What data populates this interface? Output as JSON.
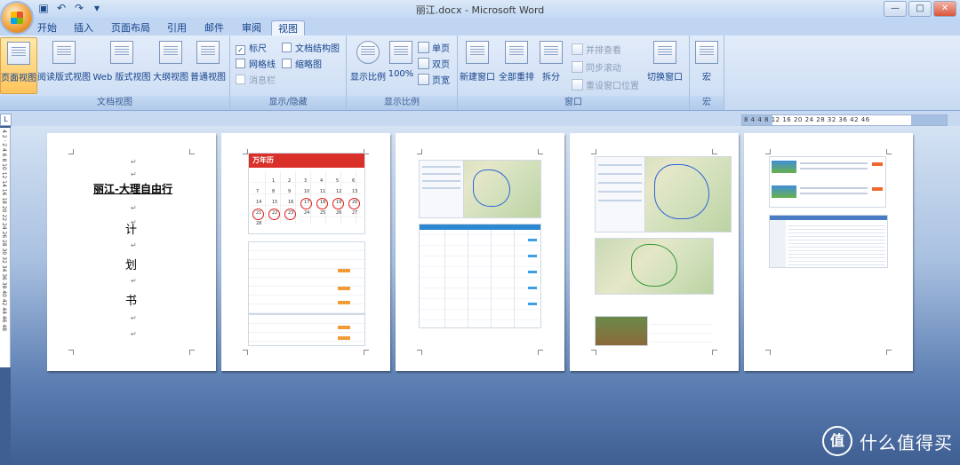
{
  "window": {
    "title": "丽江.docx - Microsoft Word",
    "controls": {
      "minimize": "—",
      "maximize": "□",
      "close": "✕"
    }
  },
  "quick_access": {
    "icons": [
      "save-icon",
      "undo-icon",
      "redo-icon",
      "customize-icon"
    ],
    "glyphs": [
      "▣",
      "↶",
      "↷",
      "▾"
    ]
  },
  "tabs": [
    {
      "label": "开始",
      "active": false
    },
    {
      "label": "插入",
      "active": false
    },
    {
      "label": "页面布局",
      "active": false
    },
    {
      "label": "引用",
      "active": false
    },
    {
      "label": "邮件",
      "active": false
    },
    {
      "label": "审阅",
      "active": false
    },
    {
      "label": "视图",
      "active": true
    }
  ],
  "ribbon": {
    "doc_views": {
      "label": "文档视图",
      "buttons": [
        {
          "label": "页面视图",
          "active": true
        },
        {
          "label": "阅读版式视图",
          "active": false
        },
        {
          "label": "Web 版式视图",
          "active": false
        },
        {
          "label": "大纲视图",
          "active": false
        },
        {
          "label": "普通视图",
          "active": false
        }
      ]
    },
    "show_hide": {
      "label": "显示/隐藏",
      "items": [
        {
          "label": "标尺",
          "checked": true,
          "enabled": true
        },
        {
          "label": "文档结构图",
          "checked": false,
          "enabled": true
        },
        {
          "label": "网格线",
          "checked": false,
          "enabled": true
        },
        {
          "label": "缩略图",
          "checked": false,
          "enabled": true
        },
        {
          "label": "消息栏",
          "checked": false,
          "enabled": false
        }
      ]
    },
    "zoom": {
      "label": "显示比例",
      "zoom_btn": "显示比例",
      "hundred_btn": "100%",
      "one_page": "单页",
      "two_pages": "双页",
      "page_width": "页宽"
    },
    "window": {
      "label": "窗口",
      "new_window": "新建窗口",
      "arrange_all": "全部重排",
      "split": "拆分",
      "side_by_side": "并排查看",
      "sync_scroll": "同步滚动",
      "reset_position": "重设窗口位置",
      "switch_windows": "切换窗口"
    },
    "macros": {
      "label": "宏",
      "button": "宏"
    }
  },
  "ruler": {
    "corner": "L",
    "horizontal_ticks": "8  4     4   8  12  16  20  24  28  32  36  42  46",
    "vertical_ticks": "4 2 · 2 4 6 8 10 12 14 16 18 20 22 24 26 28 30 32 34 36 38 40 42 44 46 48"
  },
  "pages": [
    {
      "title": "丽江-大理自由行",
      "chars": [
        "计",
        "划",
        "书"
      ],
      "para_mark": "↵"
    }
  ],
  "page2": {
    "calendar_logo": "万年历",
    "calendar_days": [
      "1",
      "2",
      "3",
      "4",
      "5",
      "6",
      "7",
      "8",
      "9",
      "10",
      "11",
      "12",
      "13",
      "14",
      "15",
      "16",
      "17",
      "18",
      "19",
      "20",
      "21",
      "22",
      "23",
      "24",
      "25",
      "26",
      "27",
      "28"
    ]
  },
  "watermark": {
    "glyph": "值",
    "text": "什么值得买"
  }
}
